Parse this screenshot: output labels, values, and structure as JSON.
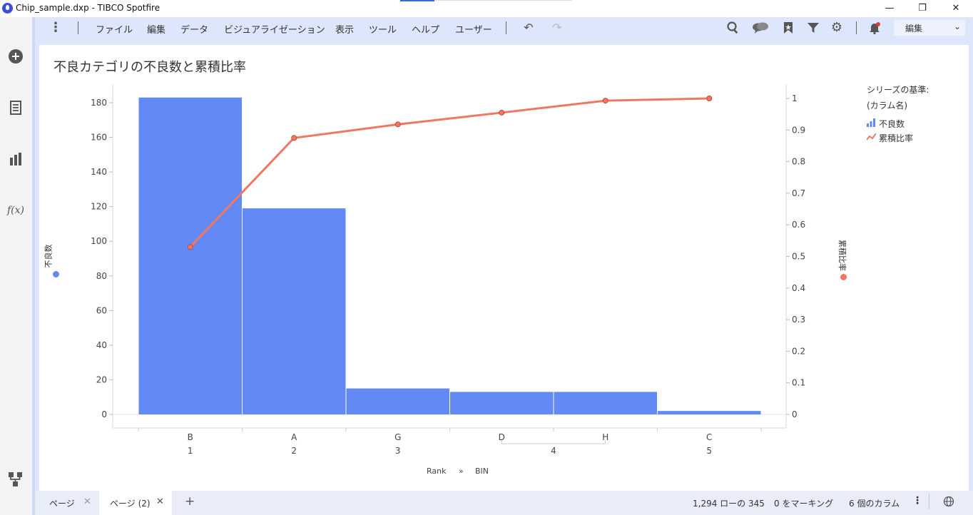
{
  "window": {
    "title": "Chip_sample.dxp - TIBCO Spotfire",
    "minimize": "—",
    "restore": "❐",
    "close": "✕"
  },
  "menu": {
    "items": [
      "ファイル",
      "編集",
      "データ",
      "ビジュアライゼーション",
      "表示",
      "ツール",
      "ヘルプ",
      "ユーザー"
    ],
    "mode": "編集"
  },
  "visualization": {
    "title": "不良カテゴリの不良数と累積比率",
    "left_axis_label": "不良数",
    "right_axis_label": "累積比率",
    "legend_title": "シリーズの基準:",
    "legend_subtitle": "(カラム名)",
    "legend_items": [
      "不良数",
      "累積比率"
    ],
    "x_hierarchy": [
      "Rank",
      "»",
      "BIN"
    ],
    "bar_color": "#6389f5",
    "line_color": "#ef7863"
  },
  "chart_data": {
    "type": "bar",
    "title": "不良カテゴリの不良数と累積比率",
    "categories": [
      "B",
      "A",
      "G",
      "D",
      "H",
      "C"
    ],
    "rank_labels": [
      "1",
      "2",
      "3",
      "4",
      "5"
    ],
    "rank_groups": [
      [
        0
      ],
      [
        1
      ],
      [
        2
      ],
      [
        3,
        4
      ],
      [
        5
      ]
    ],
    "ylim": [
      0,
      190
    ],
    "y_ticks": [
      0,
      20,
      40,
      60,
      80,
      100,
      120,
      140,
      160,
      180
    ],
    "y2lim": [
      0,
      1.02
    ],
    "y2_ticks": [
      "0",
      "0.1",
      "0.2",
      "0.3",
      "0.4",
      "0.5",
      "0.6",
      "0.7",
      "0.8",
      "0.9",
      "1"
    ],
    "series": [
      {
        "name": "不良数",
        "type": "bar",
        "values": [
          183,
          119,
          15,
          13,
          13,
          2
        ]
      },
      {
        "name": "累積比率",
        "type": "line",
        "axis": "right",
        "points": [
          [
            0,
            0.53
          ],
          [
            1,
            0.875
          ],
          [
            2,
            0.918
          ],
          [
            3,
            0.955
          ],
          [
            4,
            0.993
          ],
          [
            5,
            1.0
          ]
        ]
      }
    ],
    "legend": "right",
    "grid": false
  },
  "pages": [
    {
      "label": "ページ"
    },
    {
      "label": "ページ (2)"
    }
  ],
  "status": {
    "rows": "1,294 ローの 345",
    "marked": "0 をマーキング",
    "columns": "6 個のカラム"
  }
}
